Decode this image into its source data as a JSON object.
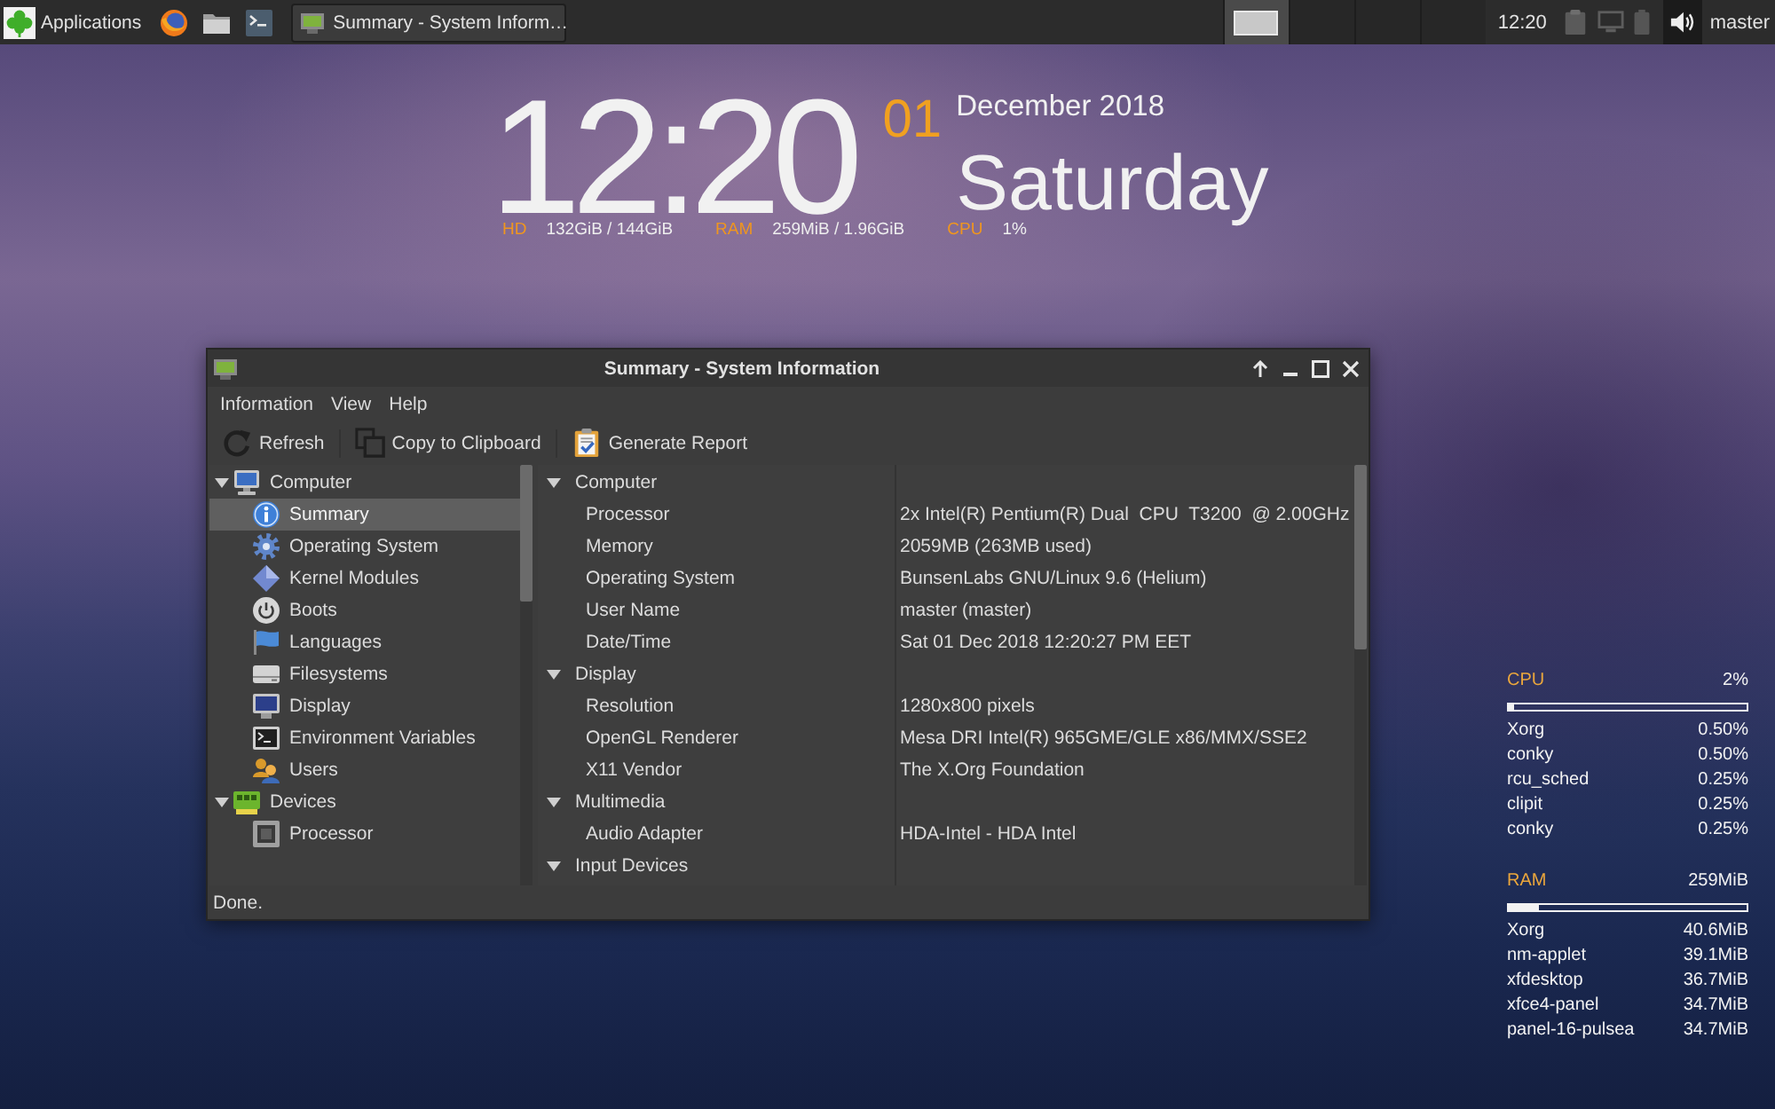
{
  "top_panel": {
    "applications": "Applications",
    "tasks": [
      {
        "title": "Summary - System Inform…",
        "selected": true
      }
    ],
    "workspaces": [
      {
        "selected": true,
        "has_window": true
      },
      {
        "selected": false,
        "has_window": false
      },
      {
        "selected": false,
        "has_window": false
      },
      {
        "selected": false,
        "has_window": false
      }
    ],
    "clock": "12:20",
    "user": "master"
  },
  "desktop_clock": {
    "time": "12:20",
    "day": "01",
    "month_year": "December 2018",
    "weekday": "Saturday",
    "stats": [
      {
        "label": "HD",
        "value": "132GiB / 144GiB"
      },
      {
        "label": "RAM",
        "value": "259MiB / 1.96GiB"
      },
      {
        "label": "CPU",
        "value": "1%"
      }
    ]
  },
  "window": {
    "title": "Summary - System Information",
    "menu": [
      "Information",
      "View",
      "Help"
    ],
    "toolbar": [
      "Refresh",
      "Copy to Clipboard",
      "Generate Report"
    ],
    "tree": [
      {
        "label": "Computer",
        "expanded": true,
        "selected": false,
        "children": [
          {
            "label": "Summary",
            "selected": true
          },
          {
            "label": "Operating System",
            "selected": false
          },
          {
            "label": "Kernel Modules",
            "selected": false
          },
          {
            "label": "Boots",
            "selected": false
          },
          {
            "label": "Languages",
            "selected": false
          },
          {
            "label": "Filesystems",
            "selected": false
          },
          {
            "label": "Display",
            "selected": false
          },
          {
            "label": "Environment Variables",
            "selected": false
          },
          {
            "label": "Users",
            "selected": false
          }
        ]
      },
      {
        "label": "Devices",
        "expanded": true,
        "selected": false,
        "children": [
          {
            "label": "Processor",
            "selected": false
          }
        ]
      }
    ],
    "details": [
      {
        "title": "Computer",
        "expanded": true,
        "rows": [
          {
            "label": "Processor",
            "value": "2x Intel(R) Pentium(R) Dual  CPU  T3200  @ 2.00GHz"
          },
          {
            "label": "Memory",
            "value": "2059MB (263MB used)"
          },
          {
            "label": "Operating System",
            "value": "BunsenLabs GNU/Linux 9.6 (Helium)"
          },
          {
            "label": "User Name",
            "value": "master (master)"
          },
          {
            "label": "Date/Time",
            "value": "Sat 01 Dec 2018 12:20:27 PM EET"
          }
        ]
      },
      {
        "title": "Display",
        "expanded": true,
        "rows": [
          {
            "label": "Resolution",
            "value": "1280x800 pixels"
          },
          {
            "label": "OpenGL Renderer",
            "value": "Mesa DRI Intel(R) 965GME/GLE x86/MMX/SSE2"
          },
          {
            "label": "X11 Vendor",
            "value": "The X.Org Foundation"
          }
        ]
      },
      {
        "title": "Multimedia",
        "expanded": true,
        "rows": [
          {
            "label": "Audio Adapter",
            "value": "HDA-Intel - HDA Intel"
          }
        ]
      },
      {
        "title": "Input Devices",
        "expanded": true
      }
    ],
    "status": "Done."
  },
  "system_monitor": {
    "meters": [
      {
        "label": "CPU",
        "reading": "2%",
        "level": 0.02,
        "processes": [
          {
            "name": "Xorg",
            "value": "0.50%"
          },
          {
            "name": "conky",
            "value": "0.50%"
          },
          {
            "name": "rcu_sched",
            "value": "0.25%"
          },
          {
            "name": "clipit",
            "value": "0.25%"
          },
          {
            "name": "conky",
            "value": "0.25%"
          }
        ]
      },
      {
        "label": "RAM",
        "reading": "259MiB",
        "level": 0.13,
        "processes": [
          {
            "name": "Xorg",
            "value": "40.6MiB"
          },
          {
            "name": "nm-applet",
            "value": "39.1MiB"
          },
          {
            "name": "xfdesktop",
            "value": "36.7MiB"
          },
          {
            "name": "xfce4-panel",
            "value": "34.7MiB"
          },
          {
            "name": "panel-16-pulsea",
            "value": "34.7MiB"
          }
        ]
      }
    ]
  }
}
